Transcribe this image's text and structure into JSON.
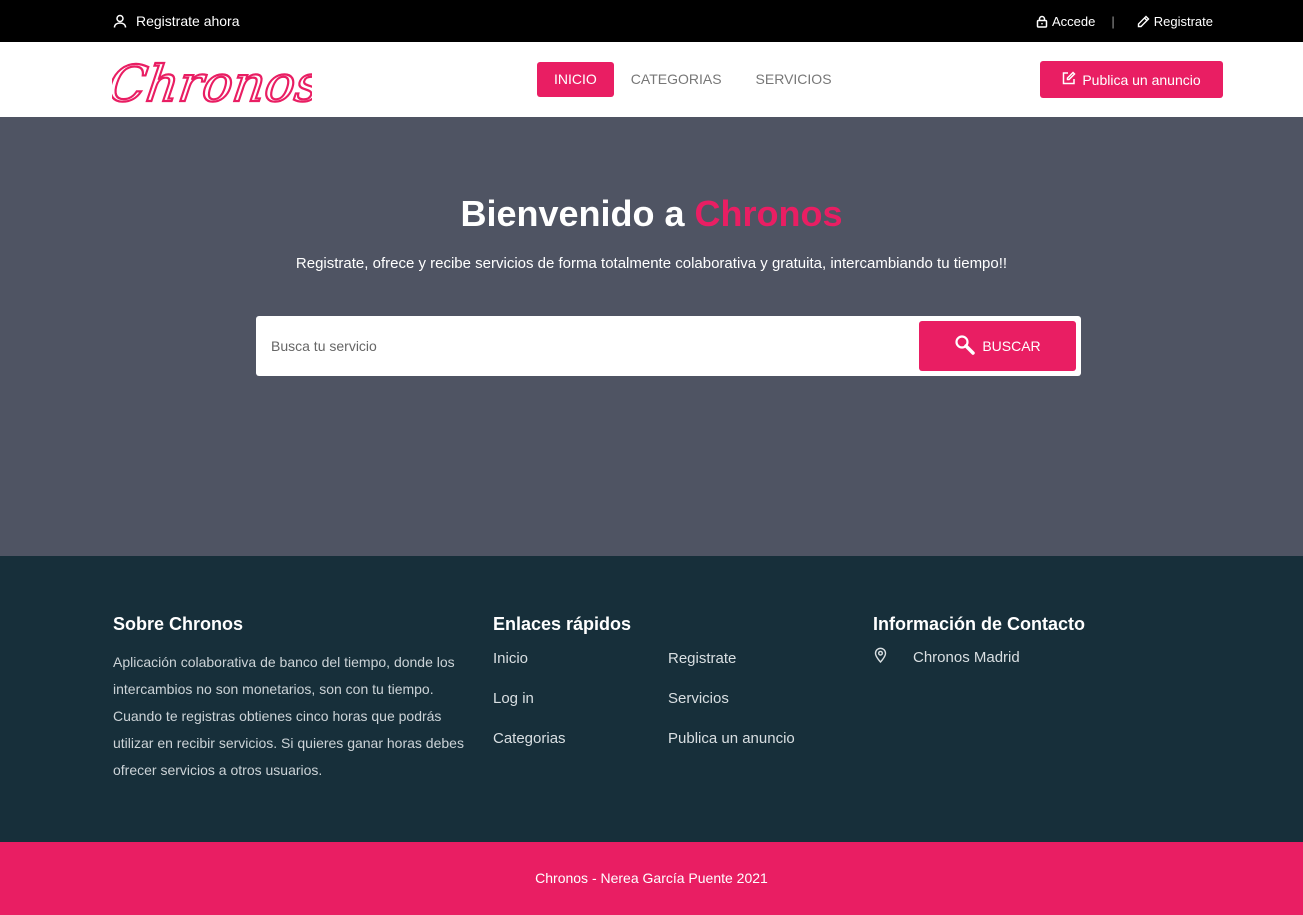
{
  "topbar": {
    "register_now": "Registrate ahora",
    "login": "Accede",
    "separator": "|",
    "register": "Registrate"
  },
  "navbar": {
    "logo_text": "Chronos",
    "items": [
      {
        "label": "INICIO",
        "active": true
      },
      {
        "label": "CATEGORIAS",
        "active": false
      },
      {
        "label": "SERVICIOS",
        "active": false
      }
    ],
    "publish_label": "Publica un anuncio"
  },
  "hero": {
    "title_prefix": "Bienvenido a ",
    "title_accent": "Chronos",
    "subtitle": "Registrate, ofrece y recibe servicios de forma totalmente colaborativa y gratuita, intercambiando tu tiempo!!",
    "search_placeholder": "Busca tu servicio",
    "search_value": "",
    "search_button": "BUSCAR"
  },
  "footer": {
    "about": {
      "title": "Sobre Chronos",
      "text": "Aplicación colaborativa de banco del tiempo, donde los intercambios no son monetarios, son con tu tiempo. Cuando te registras obtienes cinco horas que podrás utilizar en recibir servicios. Si quieres ganar horas debes ofrecer servicios a otros usuarios."
    },
    "links": {
      "title": "Enlaces rápidos",
      "items": [
        "Inicio",
        "Registrate",
        "Log in",
        "Servicios",
        "Categorias",
        "Publica un anuncio"
      ]
    },
    "contact": {
      "title": "Información de Contacto",
      "location": "Chronos Madrid"
    }
  },
  "bottombar": {
    "copyright": "Chronos - Nerea García Puente 2021"
  },
  "colors": {
    "accent": "#e91e63",
    "topbar": "#000000",
    "hero_bg": "#4f5463",
    "footer_bg": "#172f3a"
  },
  "icons": {
    "user": "user-icon",
    "lock": "lock-icon",
    "pencil": "pencil-icon",
    "edit": "edit-square-icon",
    "search": "search-icon",
    "location": "map-pin-icon"
  }
}
